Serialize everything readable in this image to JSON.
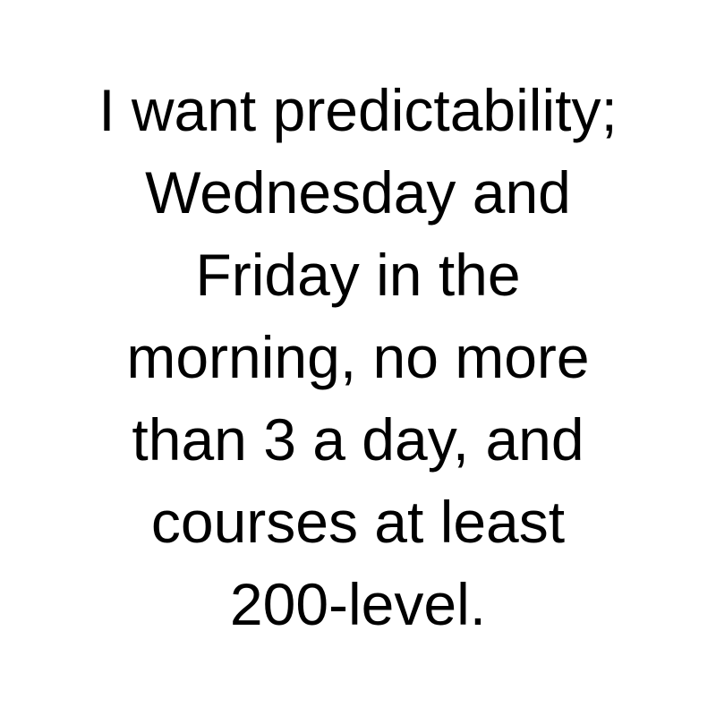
{
  "message": {
    "lines": [
      "I want predictability;",
      "Wednesday and",
      "Friday in the",
      "morning, no more",
      "than 3 a day, and",
      "courses at least",
      "200-level."
    ]
  },
  "colors": {
    "background": "#ffffff",
    "text": "#000000"
  }
}
